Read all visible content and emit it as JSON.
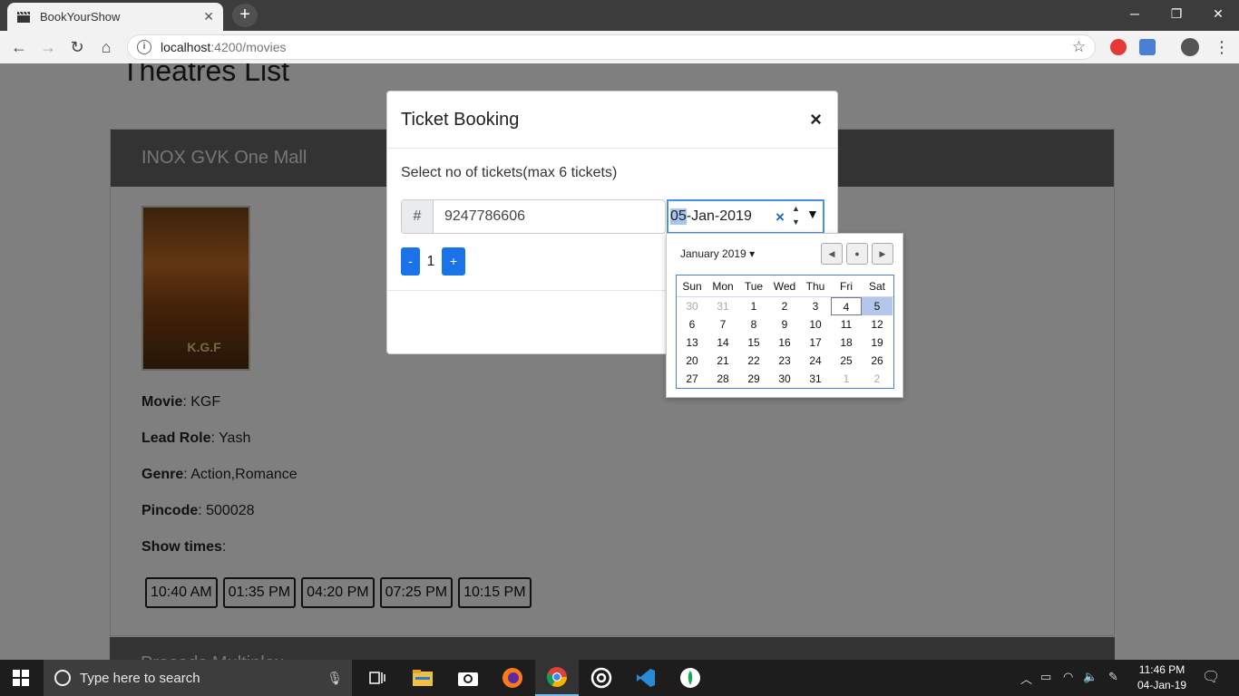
{
  "browser": {
    "tab_title": "BookYourShow",
    "tab_close": "✕",
    "new_tab": "+",
    "url_host": "localhost",
    "url_path": ":4200/movies",
    "win_min": "─",
    "win_max": "❐",
    "win_close": "✕"
  },
  "page": {
    "title": "Theatres List",
    "theatre": {
      "name": "INOX GVK One Mall",
      "poster_text": "K.G.F",
      "movie_label": "Movie",
      "movie": ": KGF",
      "lead_label": "Lead Role",
      "lead": ": Yash",
      "genre_label": "Genre",
      "genre": ": Action,Romance",
      "pincode_label": "Pincode",
      "pincode": ": 500028",
      "showtimes_label": "Show times",
      "showtimes_colon": ":",
      "showtimes": [
        "10:40 AM",
        "01:35 PM",
        "04:20 PM",
        "07:25 PM",
        "10:15 PM"
      ]
    },
    "next_theatre": "Prasads Multiplex"
  },
  "modal": {
    "title": "Ticket Booking",
    "close": "×",
    "subtitle": "Select no of tickets(max 6 tickets)",
    "phone_addon": "#",
    "phone_value": "9247786606",
    "date_day": "05",
    "date_rest": "-Jan-2019",
    "date_clear": "×",
    "date_dropdown": "▼",
    "minus": "-",
    "plus": "+",
    "quantity": "1"
  },
  "calendar": {
    "month_label": "January 2019",
    "month_caret": "▾",
    "prev": "◀",
    "today": "●",
    "next": "▶",
    "weekdays": [
      "Sun",
      "Mon",
      "Tue",
      "Wed",
      "Thu",
      "Fri",
      "Sat"
    ],
    "weeks": [
      [
        "30",
        "31",
        "1",
        "2",
        "3",
        "4",
        "5"
      ],
      [
        "6",
        "7",
        "8",
        "9",
        "10",
        "11",
        "12"
      ],
      [
        "13",
        "14",
        "15",
        "16",
        "17",
        "18",
        "19"
      ],
      [
        "20",
        "21",
        "22",
        "23",
        "24",
        "25",
        "26"
      ],
      [
        "27",
        "28",
        "29",
        "30",
        "31",
        "1",
        "2"
      ]
    ]
  },
  "taskbar": {
    "search_placeholder": "Type here to search",
    "time": "11:46 PM",
    "date": "04-Jan-19"
  },
  "colors": {
    "primary": "#1a73e8",
    "selected_day": "#b4c7ea",
    "card_header": "#666666"
  }
}
